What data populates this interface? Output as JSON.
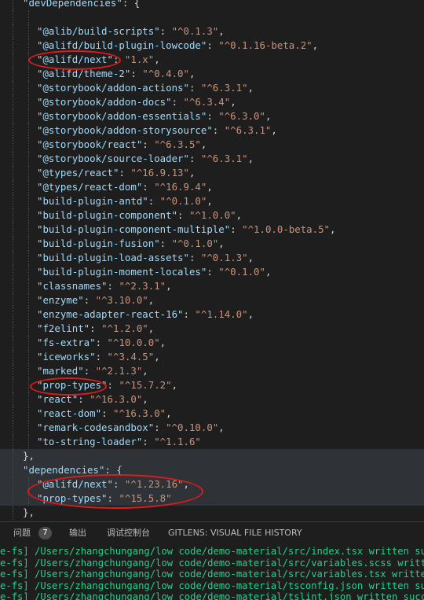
{
  "editor": {
    "dev_dependencies_key": "\"devDependencies\"",
    "dependencies_key": "\"dependencies\"",
    "dev_dependencies": [
      {
        "name": "\"@alib/build-scripts\"",
        "version": "\"^0.1.3\"",
        "trailing": ","
      },
      {
        "name": "\"@alifd/build-plugin-lowcode\"",
        "version": "\"^0.1.16-beta.2\"",
        "trailing": ","
      },
      {
        "name": "\"@alifd/next\"",
        "version": "\"1.x\"",
        "trailing": ","
      },
      {
        "name": "\"@alifd/theme-2\"",
        "version": "\"^0.4.0\"",
        "trailing": ","
      },
      {
        "name": "\"@storybook/addon-actions\"",
        "version": "\"^6.3.1\"",
        "trailing": ","
      },
      {
        "name": "\"@storybook/addon-docs\"",
        "version": "\"^6.3.4\"",
        "trailing": ","
      },
      {
        "name": "\"@storybook/addon-essentials\"",
        "version": "\"^6.3.0\"",
        "trailing": ","
      },
      {
        "name": "\"@storybook/addon-storysource\"",
        "version": "\"^6.3.1\"",
        "trailing": ","
      },
      {
        "name": "\"@storybook/react\"",
        "version": "\"^6.3.5\"",
        "trailing": ","
      },
      {
        "name": "\"@storybook/source-loader\"",
        "version": "\"^6.3.1\"",
        "trailing": ","
      },
      {
        "name": "\"@types/react\"",
        "version": "\"^16.9.13\"",
        "trailing": ","
      },
      {
        "name": "\"@types/react-dom\"",
        "version": "\"^16.9.4\"",
        "trailing": ","
      },
      {
        "name": "\"build-plugin-antd\"",
        "version": "\"^0.1.0\"",
        "trailing": ","
      },
      {
        "name": "\"build-plugin-component\"",
        "version": "\"^1.0.0\"",
        "trailing": ","
      },
      {
        "name": "\"build-plugin-component-multiple\"",
        "version": "\"^1.0.0-beta.5\"",
        "trailing": ","
      },
      {
        "name": "\"build-plugin-fusion\"",
        "version": "\"^0.1.0\"",
        "trailing": ","
      },
      {
        "name": "\"build-plugin-load-assets\"",
        "version": "\"^0.1.3\"",
        "trailing": ","
      },
      {
        "name": "\"build-plugin-moment-locales\"",
        "version": "\"^0.1.0\"",
        "trailing": ","
      },
      {
        "name": "\"classnames\"",
        "version": "\"^2.3.1\"",
        "trailing": ","
      },
      {
        "name": "\"enzyme\"",
        "version": "\"^3.10.0\"",
        "trailing": ","
      },
      {
        "name": "\"enzyme-adapter-react-16\"",
        "version": "\"^1.14.0\"",
        "trailing": ","
      },
      {
        "name": "\"f2elint\"",
        "version": "\"^1.2.0\"",
        "trailing": ","
      },
      {
        "name": "\"fs-extra\"",
        "version": "\"^10.0.0\"",
        "trailing": ","
      },
      {
        "name": "\"iceworks\"",
        "version": "\"^3.4.5\"",
        "trailing": ","
      },
      {
        "name": "\"marked\"",
        "version": "\"^2.1.3\"",
        "trailing": ","
      },
      {
        "name": "\"prop-types\"",
        "version": "\"^15.7.2\"",
        "trailing": ","
      },
      {
        "name": "\"react\"",
        "version": "\"^16.3.0\"",
        "trailing": ","
      },
      {
        "name": "\"react-dom\"",
        "version": "\"^16.3.0\"",
        "trailing": ","
      },
      {
        "name": "\"remark-codesandbox\"",
        "version": "\"^0.10.0\"",
        "trailing": ","
      },
      {
        "name": "\"to-string-loader\"",
        "version": "\"^1.1.6\"",
        "trailing": ""
      }
    ],
    "dependencies": [
      {
        "name": "\"@alifd/next\"",
        "version": "\"^1.23.16\"",
        "trailing": ","
      },
      {
        "name": "\"prop-types\"",
        "version": "\"^15.5.8\"",
        "trailing": ""
      }
    ]
  },
  "panel": {
    "tabs": [
      {
        "label": "问题",
        "badge": "7"
      },
      {
        "label": "输出"
      },
      {
        "label": "调试控制台"
      },
      {
        "label": "GITLENS: VISUAL FILE HISTORY"
      }
    ]
  },
  "terminal": {
    "lines": [
      "e-fs] /Users/zhangchungang/low code/demo-material/src/index.tsx written successfully",
      "e-fs] /Users/zhangchungang/low code/demo-material/src/variables.scss written successfully",
      "e-fs] /Users/zhangchungang/low code/demo-material/src/variables.tsx written successfully",
      "e-fs] /Users/zhangchungang/low code/demo-material/tsconfig.json written successfully",
      "e-fs] /Users/zhangchungang/low code/demo-material/tslint.json written successfully"
    ],
    "color": "#23d18b"
  },
  "colors": {
    "background": "#1e1e1e",
    "json_key": "#9cdcfe",
    "json_string": "#ce9178",
    "annotation_ellipse": "#e01b1b"
  }
}
